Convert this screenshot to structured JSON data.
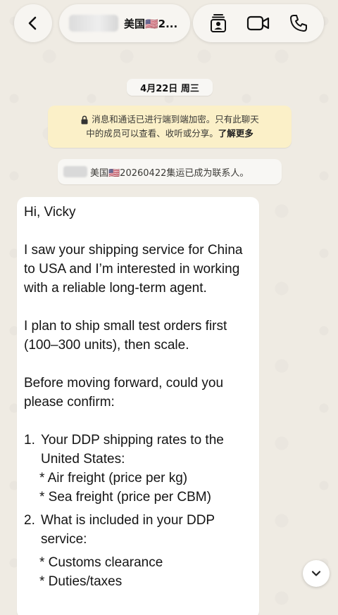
{
  "header": {
    "title": "美国🇺🇸2...",
    "back_icon": "chevron-left-icon",
    "actions": [
      "contact-card-icon",
      "video-call-icon",
      "phone-call-icon"
    ]
  },
  "date_chip": "4月22日 周三",
  "encryption_notice": {
    "line1": "消息和通话已进行端到端加密。只有此聊天",
    "line2": "中的成员可以查看、收听或分享。",
    "learn_more": "了解更多"
  },
  "contact_notice": "美国🇺🇸20260422集运已成为联系人。",
  "message": {
    "greeting": "Hi, Vicky",
    "para1": "I saw your shipping service for China to USA and I’m interested in working with a reliable long-term agent.",
    "para2": "I plan to ship small test orders first (100–300 units), then scale.",
    "para3": "Before moving forward, could you please confirm:",
    "list": [
      {
        "num": "1.",
        "text": "Your DDP shipping rates to the United States:",
        "sub": [
          "* Air freight (price per kg)",
          "* Sea freight (price per CBM)"
        ]
      },
      {
        "num": "2.",
        "text": "What is included in your DDP service:",
        "sub": [
          "* Customs clearance",
          "* Duties/taxes"
        ]
      }
    ]
  },
  "colors": {
    "background": "#efebe3",
    "notice_yellow": "#fbf0c8",
    "bubble": "#ffffff"
  }
}
